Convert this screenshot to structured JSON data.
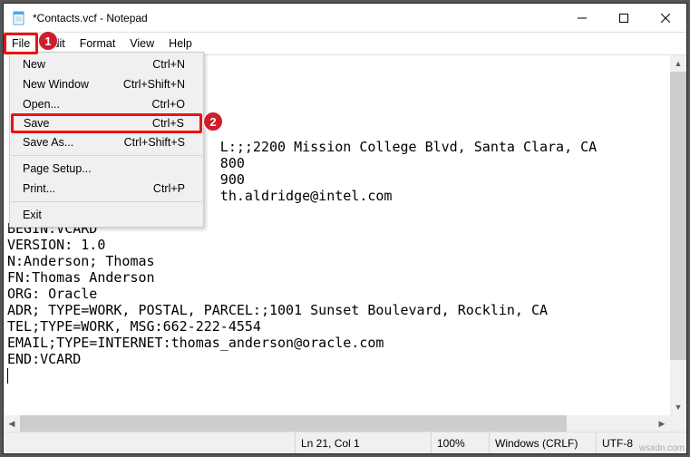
{
  "title": "*Contacts.vcf - Notepad",
  "menus": {
    "file": "File",
    "edit": "Edit",
    "format": "Format",
    "view": "View",
    "help": "Help"
  },
  "file_menu": {
    "new": {
      "label": "New",
      "shortcut": "Ctrl+N"
    },
    "new_window": {
      "label": "New Window",
      "shortcut": "Ctrl+Shift+N"
    },
    "open": {
      "label": "Open...",
      "shortcut": "Ctrl+O"
    },
    "save": {
      "label": "Save",
      "shortcut": "Ctrl+S"
    },
    "save_as": {
      "label": "Save As...",
      "shortcut": "Ctrl+Shift+S"
    },
    "page_setup": {
      "label": "Page Setup...",
      "shortcut": ""
    },
    "print": {
      "label": "Print...",
      "shortcut": "Ctrl+P"
    },
    "exit": {
      "label": "Exit",
      "shortcut": ""
    }
  },
  "badges": {
    "one": "1",
    "two": "2"
  },
  "editor_text": "\n\n\n\n\n                          L:;;2200 Mission College Blvd, Santa Clara, CA\n                          800\n                          900\n                          th.aldridge@intel.com\n\nBEGIN:VCARD\nVERSION: 1.0\nN:Anderson; Thomas\nFN:Thomas Anderson\nORG: Oracle\nADR; TYPE=WORK, POSTAL, PARCEL:;1001 Sunset Boulevard, Rocklin, CA\nTEL;TYPE=WORK, MSG:662-222-4554\nEMAIL;TYPE=INTERNET:thomas_anderson@oracle.com\nEND:VCARD",
  "status": {
    "position": "Ln 21, Col 1",
    "zoom": "100%",
    "line_ending": "Windows (CRLF)",
    "encoding": "UTF-8"
  },
  "watermark": "wsxdn.com"
}
